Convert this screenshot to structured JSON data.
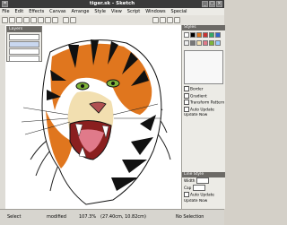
{
  "window": {
    "title": "tiger.sk - Sketch"
  },
  "menu": [
    "File",
    "Edit",
    "Effects",
    "Canvas",
    "Arrange",
    "Style",
    "View",
    "Script",
    "Windows",
    "Special"
  ],
  "layers_panel": {
    "title": "Layers"
  },
  "right_panel": {
    "styles_title": "Styles",
    "border_label": "Border",
    "gradient_label": "Gradient",
    "transform_label": "Transform Pattern",
    "auto_update": "Auto Update",
    "update_now": "Update Now",
    "line_style_title": "Line Style",
    "width_label": "Width",
    "cap_label": "Cap"
  },
  "status": {
    "tool": "Select",
    "state": "modified",
    "zoom": "107.3%",
    "coords": "(27.40cm, 10.82cm)",
    "selection": "No Selection"
  },
  "colors": {
    "orange": "#e0761e",
    "dark": "#111111",
    "cream": "#f2dfb0",
    "green": "#7fb53a"
  }
}
